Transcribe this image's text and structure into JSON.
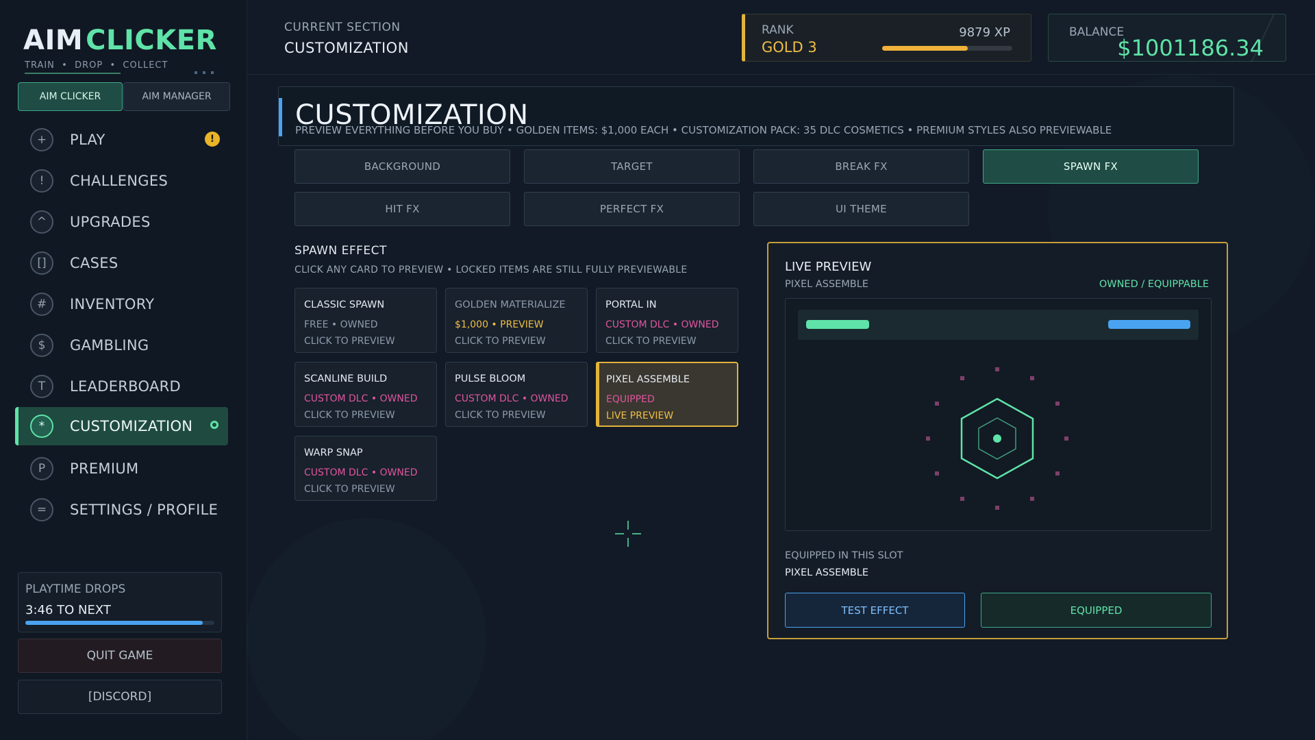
{
  "logo": {
    "part1": "AIM",
    "part2": "CLICKER",
    "tagline": "TRAIN  •  DROP  •  COLLECT"
  },
  "modes": {
    "clicker": "AIM CLICKER",
    "manager": "AIM MANAGER"
  },
  "nav": [
    {
      "icon": "+",
      "label": "PLAY"
    },
    {
      "icon": "!",
      "label": "CHALLENGES"
    },
    {
      "icon": "^",
      "label": "UPGRADES"
    },
    {
      "icon": "[]",
      "label": "CASES"
    },
    {
      "icon": "#",
      "label": "INVENTORY"
    },
    {
      "icon": "$",
      "label": "GAMBLING"
    },
    {
      "icon": "T",
      "label": "LEADERBOARD"
    },
    {
      "icon": "*",
      "label": "CUSTOMIZATION"
    },
    {
      "icon": "P",
      "label": "PREMIUM"
    },
    {
      "icon": "=",
      "label": "SETTINGS / PROFILE"
    }
  ],
  "nav_badge": "!",
  "playtime": {
    "title": "PLAYTIME DROPS",
    "value": "3:46 TO NEXT",
    "progress": 0.94
  },
  "quit_label": "QUIT GAME",
  "discord_label": "[DISCORD]",
  "header": {
    "current_label": "CURRENT SECTION",
    "current_value": "CUSTOMIZATION"
  },
  "rank": {
    "label": "RANK",
    "value": "GOLD 3",
    "xp": "9879 XP",
    "progress": 0.66
  },
  "balance": {
    "label": "BALANCE",
    "value": "$1001186.34"
  },
  "page": {
    "title": "CUSTOMIZATION",
    "subtitle": "PREVIEW EVERYTHING BEFORE YOU BUY • GOLDEN ITEMS: $1,000 EACH • CUSTOMIZATION PACK: 35 DLC COSMETICS • PREMIUM STYLES ALSO PREVIEWABLE"
  },
  "tabs": [
    "BACKGROUND",
    "TARGET",
    "BREAK FX",
    "SPAWN FX",
    "HIT FX",
    "PERFECT FX",
    "UI THEME"
  ],
  "section": {
    "title": "SPAWN EFFECT",
    "subtitle": "CLICK ANY CARD TO PREVIEW • LOCKED ITEMS ARE STILL FULLY PREVIEWABLE"
  },
  "cards": [
    {
      "name": "CLASSIC SPAWN",
      "status": "FREE • OWNED",
      "hint": "CLICK TO PREVIEW"
    },
    {
      "name": "GOLDEN MATERIALIZE",
      "status": "$1,000 • PREVIEW",
      "hint": "CLICK TO PREVIEW"
    },
    {
      "name": "PORTAL IN",
      "status": "CUSTOM DLC • OWNED",
      "hint": "CLICK TO PREVIEW"
    },
    {
      "name": "SCANLINE BUILD",
      "status": "CUSTOM DLC • OWNED",
      "hint": "CLICK TO PREVIEW"
    },
    {
      "name": "PULSE BLOOM",
      "status": "CUSTOM DLC • OWNED",
      "hint": "CLICK TO PREVIEW"
    },
    {
      "name": "PIXEL ASSEMBLE",
      "status": "EQUIPPED",
      "hint": "LIVE PREVIEW"
    },
    {
      "name": "WARP SNAP",
      "status": "CUSTOM DLC • OWNED",
      "hint": "CLICK TO PREVIEW"
    }
  ],
  "colors": {
    "accent_green": "#5fe3a8",
    "gold": "#f0bf45",
    "dlc_pink": "#e0559e",
    "blue": "#4aa3f0"
  },
  "preview": {
    "title": "LIVE PREVIEW",
    "item_name": "PIXEL ASSEMBLE",
    "status": "OWNED / EQUIPPABLE",
    "equipped_label": "EQUIPPED IN THIS SLOT",
    "equipped_value": "PIXEL ASSEMBLE",
    "test_label": "TEST EFFECT",
    "equipped_btn": "EQUIPPED"
  }
}
